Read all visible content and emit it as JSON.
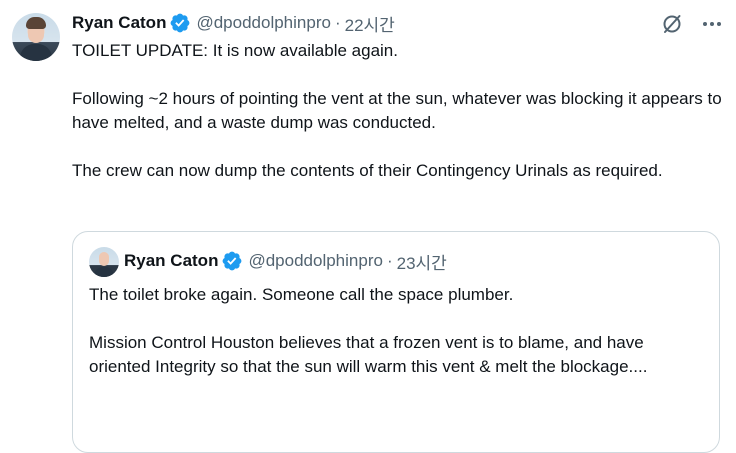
{
  "tweet": {
    "author_name": "Ryan Caton",
    "author_handle": "@dpoddolphinpro",
    "separator": "·",
    "timestamp": "22시간",
    "paragraphs": [
      "TOILET UPDATE: It is now available again.",
      "Following ~2 hours of pointing the vent at the sun, whatever was blocking it appears to have melted, and a waste dump was conducted.",
      "The crew can now dump the contents of their Contingency Urinals as required."
    ]
  },
  "quoted_tweet": {
    "author_name": "Ryan Caton",
    "author_handle": "@dpoddolphinpro",
    "separator": "·",
    "timestamp": "23시간",
    "paragraphs": [
      "The toilet broke again. Someone call the space plumber.",
      "Mission Control Houston believes that a frozen vent is to blame, and have oriented Integrity so that the sun will warm this vent & melt the blockage...."
    ]
  },
  "icons": {
    "verified": "verified-badge-icon",
    "grok": "grok-icon",
    "more": "more-icon"
  },
  "colors": {
    "verified_blue": "#1d9bf0",
    "text_primary": "#0f1419",
    "text_secondary": "#536471",
    "border": "#cfd9de"
  }
}
